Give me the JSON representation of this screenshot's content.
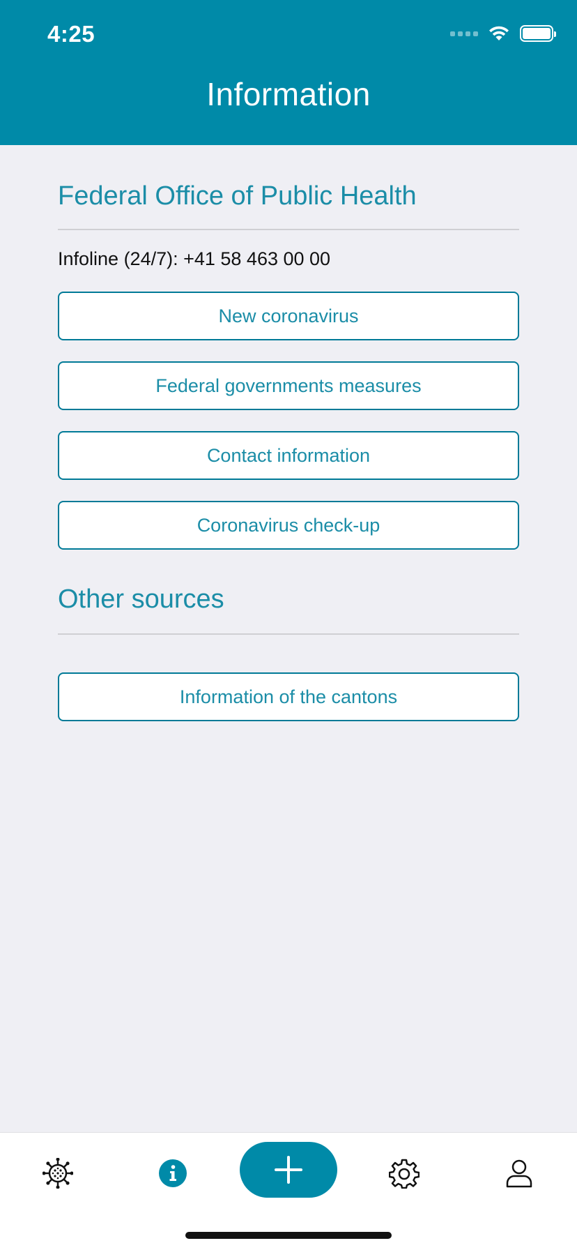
{
  "status_bar": {
    "time": "4:25"
  },
  "header": {
    "title": "Information"
  },
  "sections": [
    {
      "title": "Federal Office of Public Health",
      "infoline": "Infoline (24/7): +41 58 463 00 00",
      "buttons": [
        {
          "label": "New coronavirus"
        },
        {
          "label": "Federal governments measures"
        },
        {
          "label": "Contact information"
        },
        {
          "label": "Coronavirus check-up"
        }
      ]
    },
    {
      "title": "Other sources",
      "buttons": [
        {
          "label": "Information of the cantons"
        }
      ]
    }
  ],
  "tabbar": {
    "items": [
      {
        "icon": "virus-icon",
        "active": false
      },
      {
        "icon": "info-icon",
        "active": true
      },
      {
        "icon": "plus-icon",
        "active": false
      },
      {
        "icon": "gear-icon",
        "active": false
      },
      {
        "icon": "person-icon",
        "active": false
      }
    ]
  },
  "colors": {
    "accent": "#008aa8",
    "link_text": "#1b8da7",
    "background": "#efeff4"
  }
}
